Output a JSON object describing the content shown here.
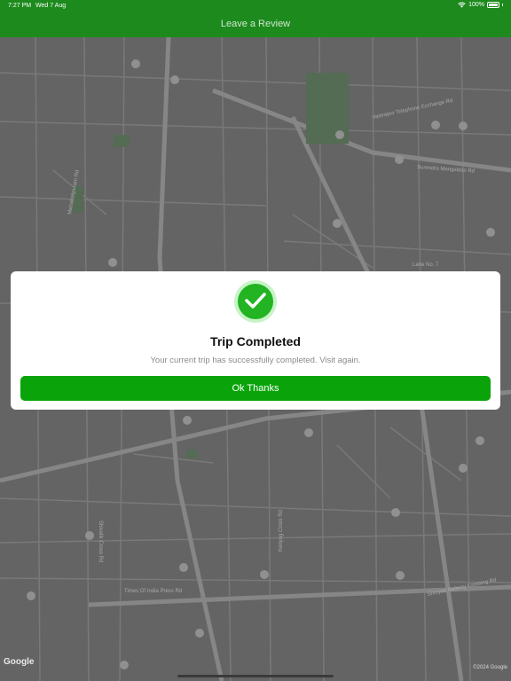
{
  "status_bar": {
    "time": "7:27 PM",
    "date": "Wed 7 Aug",
    "battery": "100%"
  },
  "nav": {
    "title": "Leave a Review"
  },
  "map": {
    "street_labels": [
      "Vastrapur Telephone Exchange Rd",
      "Surendra Mangaldas Rd",
      "Mahabalipuram Rd",
      "Lane No. 7",
      "Times Of India Press Rd",
      "Shreyas Railway Crossing Rd",
      "Shivalik Cross Rd",
      "Kenyug Cross Rd"
    ],
    "google_logo": "Google",
    "copyright": "©2024 Google"
  },
  "dialog": {
    "title": "Trip Completed",
    "message": "Your current trip has successfully completed. Visit again.",
    "button_label": "Ok Thanks"
  }
}
